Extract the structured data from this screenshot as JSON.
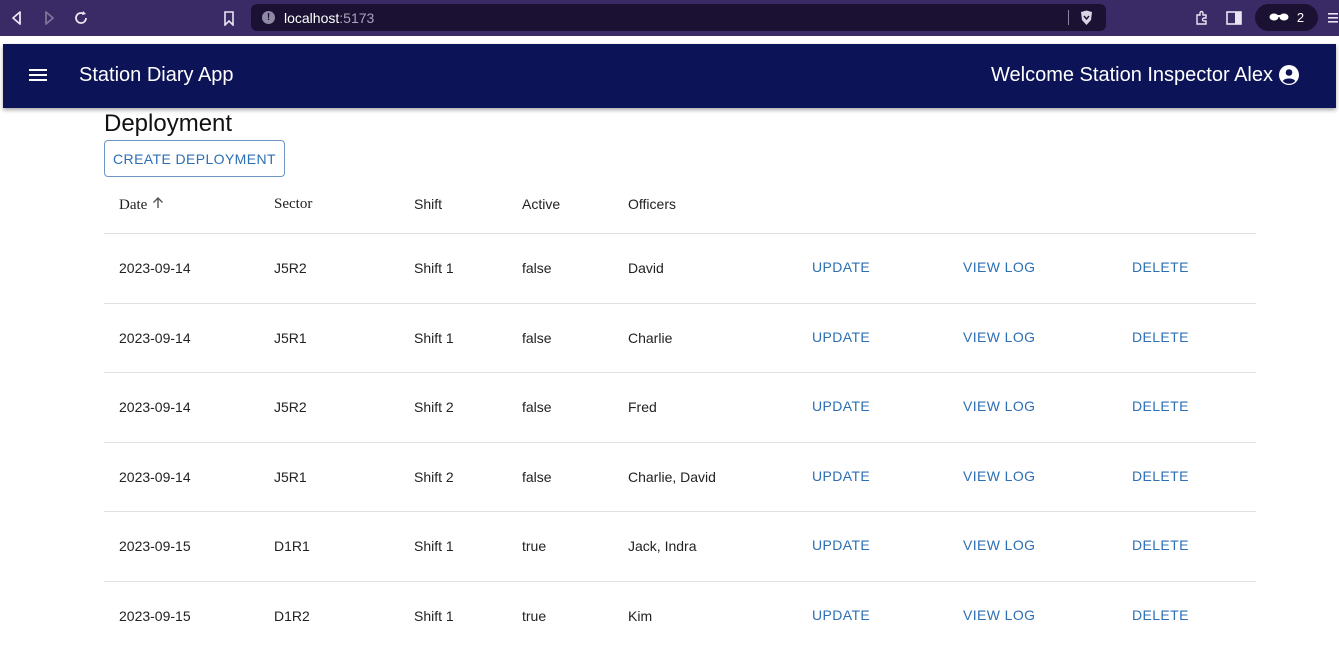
{
  "browser": {
    "url_host": "localhost",
    "url_port": ":5173",
    "extension_count": "2"
  },
  "app_bar": {
    "title": "Station Diary App",
    "welcome": "Welcome Station Inspector Alex"
  },
  "page": {
    "title": "Deployment",
    "create_button": "CREATE DEPLOYMENT"
  },
  "table": {
    "headers": {
      "date": "Date",
      "sector": "Sector",
      "shift": "Shift",
      "active": "Active",
      "officers": "Officers"
    },
    "sort": "ascending",
    "rows": [
      {
        "date": "2023-09-14",
        "sector": "J5R2",
        "shift": "Shift 1",
        "active": "false",
        "officers": "David",
        "update": "UPDATE",
        "view_log": "VIEW LOG",
        "delete": "DELETE"
      },
      {
        "date": "2023-09-14",
        "sector": "J5R1",
        "shift": "Shift 1",
        "active": "false",
        "officers": "Charlie",
        "update": "UPDATE",
        "view_log": "VIEW LOG",
        "delete": "DELETE"
      },
      {
        "date": "2023-09-14",
        "sector": "J5R2",
        "shift": "Shift 2",
        "active": "false",
        "officers": "Fred",
        "update": "UPDATE",
        "view_log": "VIEW LOG",
        "delete": "DELETE"
      },
      {
        "date": "2023-09-14",
        "sector": "J5R1",
        "shift": "Shift 2",
        "active": "false",
        "officers": "Charlie, David",
        "update": "UPDATE",
        "view_log": "VIEW LOG",
        "delete": "DELETE"
      },
      {
        "date": "2023-09-15",
        "sector": "D1R1",
        "shift": "Shift 1",
        "active": "true",
        "officers": "Jack, Indra",
        "update": "UPDATE",
        "view_log": "VIEW LOG",
        "delete": "DELETE"
      },
      {
        "date": "2023-09-15",
        "sector": "D1R2",
        "shift": "Shift 1",
        "active": "true",
        "officers": "Kim",
        "update": "UPDATE",
        "view_log": "VIEW LOG",
        "delete": "DELETE"
      }
    ]
  },
  "colors": {
    "browser_bar": "#3a2a66",
    "app_bar": "#0c1457",
    "accent": "#2d6fb4"
  },
  "icons": [
    "back-icon",
    "forward-icon",
    "reload-icon",
    "bookmark-icon",
    "info-icon",
    "brave-shield-icon",
    "extensions-icon",
    "sidebar-icon",
    "incognito-icon",
    "browser-menu-icon",
    "hamburger-menu-icon",
    "account-circle-icon",
    "sort-arrow-up-icon"
  ]
}
